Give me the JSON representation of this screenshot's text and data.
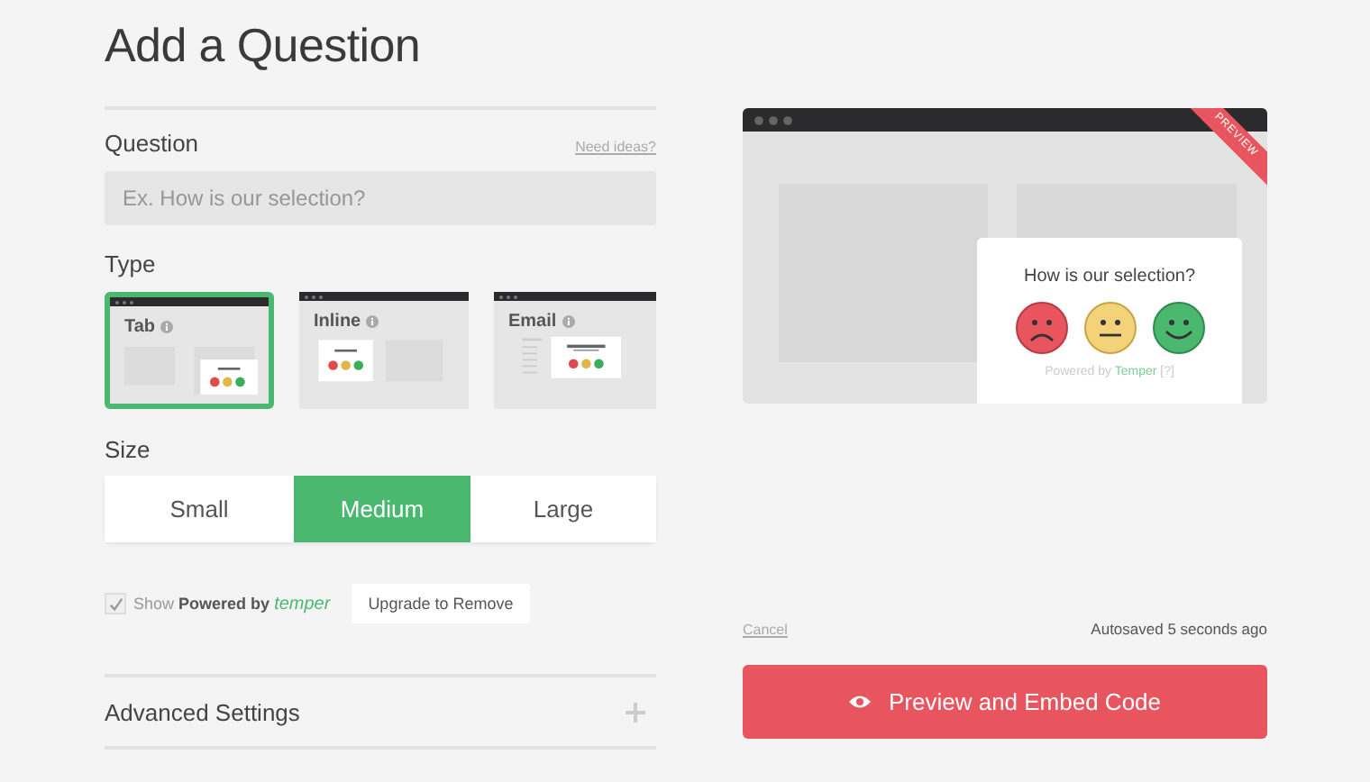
{
  "title": "Add a Question",
  "question": {
    "label": "Question",
    "help_link": "Need ideas?",
    "placeholder": "Ex. How is our selection?"
  },
  "type": {
    "label": "Type",
    "options": [
      {
        "label": "Tab",
        "kind": "tab",
        "selected": true
      },
      {
        "label": "Inline",
        "kind": "inline",
        "selected": false
      },
      {
        "label": "Email",
        "kind": "email",
        "selected": false
      }
    ]
  },
  "size": {
    "label": "Size",
    "options": [
      {
        "label": "Small",
        "selected": false
      },
      {
        "label": "Medium",
        "selected": true
      },
      {
        "label": "Large",
        "selected": false
      }
    ]
  },
  "branding": {
    "checked": true,
    "show_label": "Show",
    "powered_label": "Powered by",
    "brand": "temper",
    "upgrade_button": "Upgrade to Remove"
  },
  "advanced": {
    "label": "Advanced Settings",
    "expanded": false
  },
  "preview": {
    "ribbon": "PREVIEW",
    "question": "How is our selection?",
    "powered_label": "Powered by",
    "brand": "Temper",
    "help": "[?]"
  },
  "footer": {
    "cancel": "Cancel",
    "autosave": "Autosaved 5 seconds ago",
    "primary_button": "Preview and Embed Code"
  }
}
